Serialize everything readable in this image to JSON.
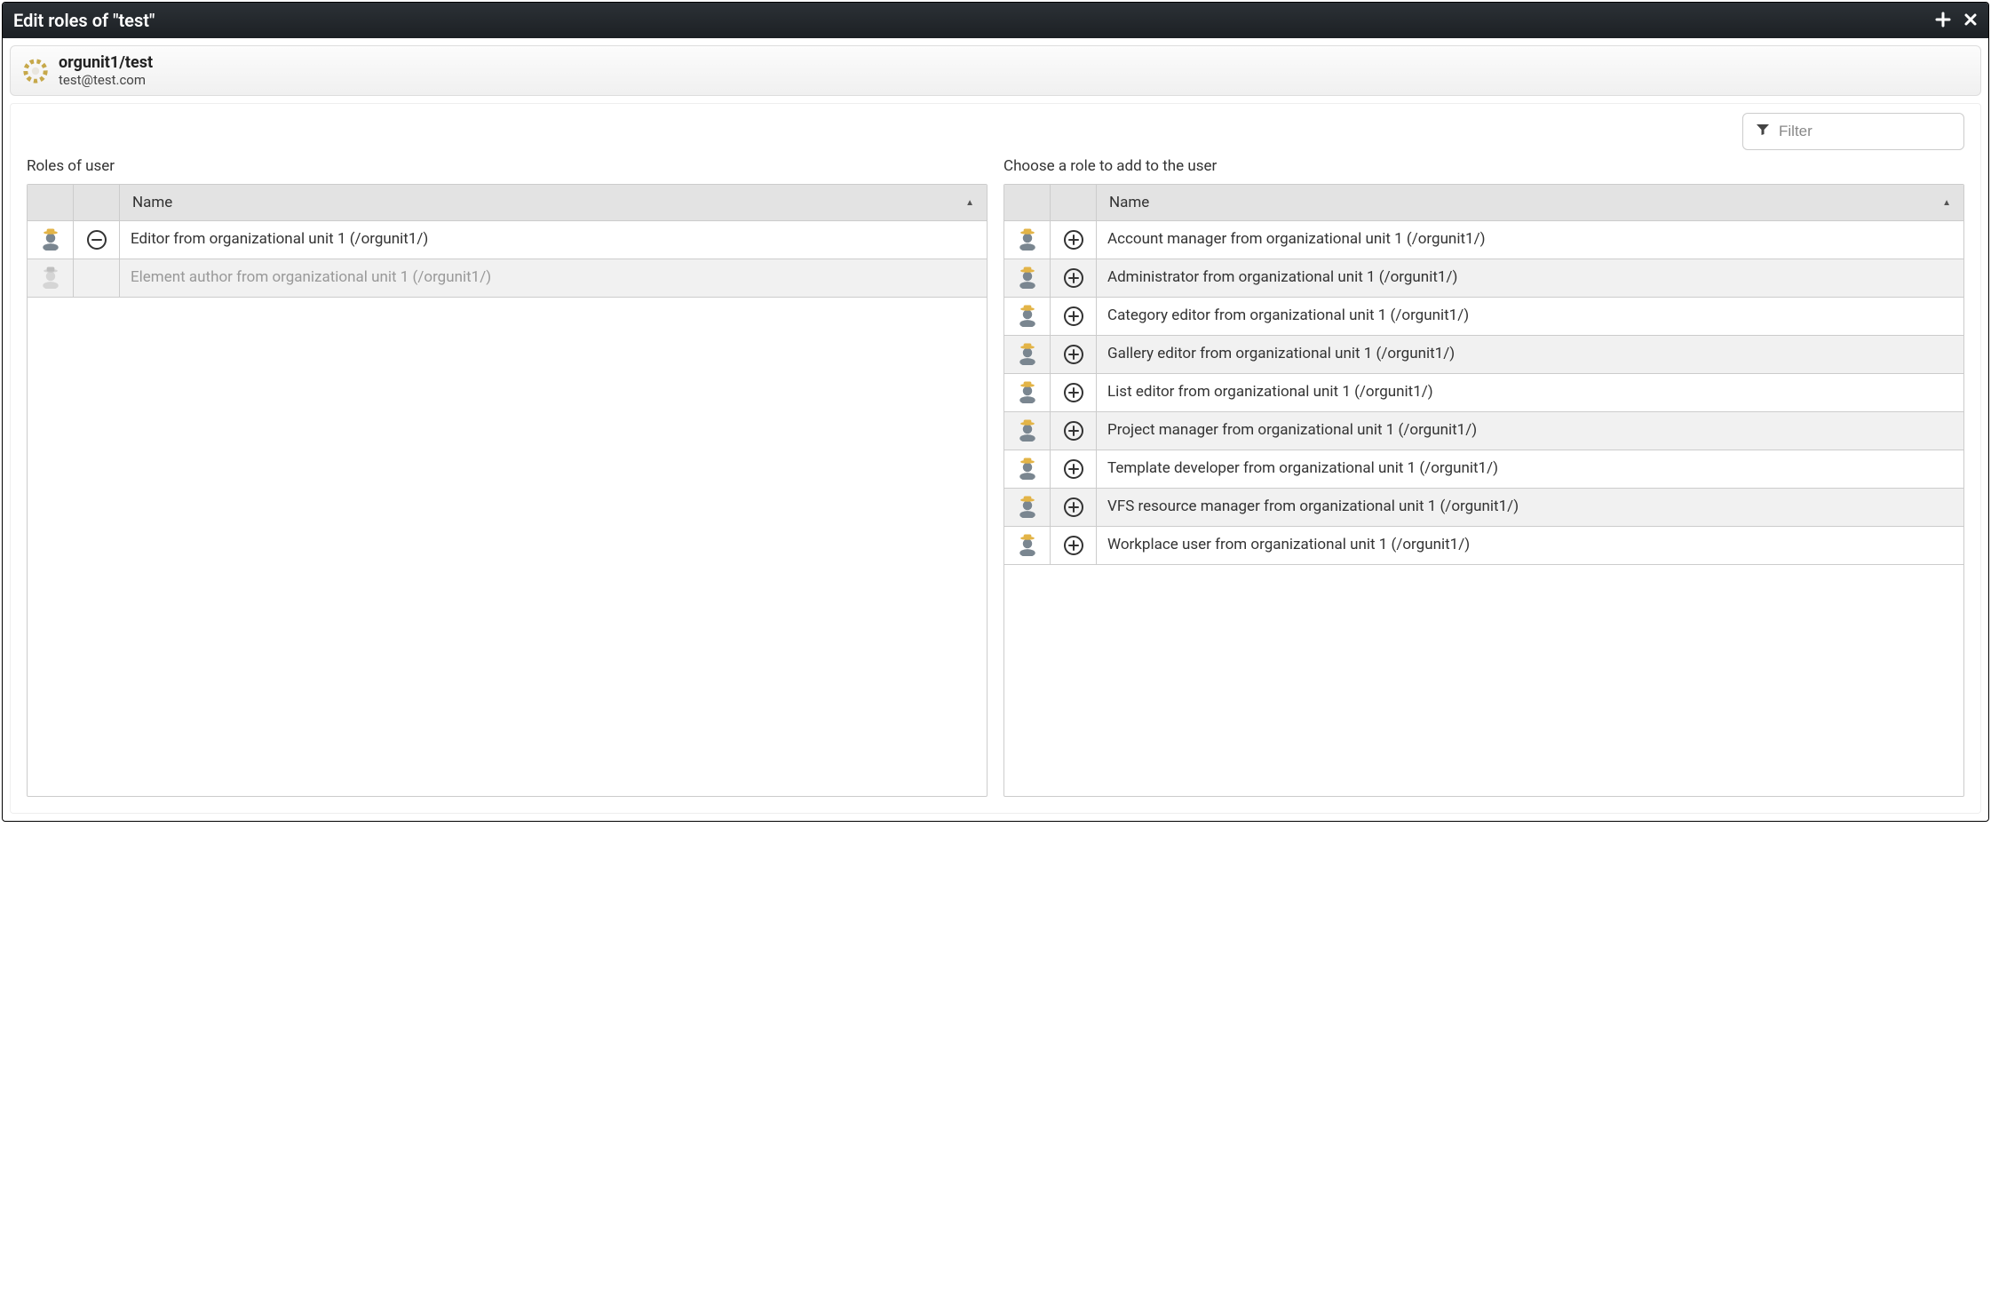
{
  "window": {
    "title": "Edit roles of \"test\""
  },
  "user": {
    "path": "orgunit1/test",
    "email": "test@test.com"
  },
  "filter": {
    "placeholder": "Filter"
  },
  "left": {
    "label": "Roles of user",
    "column_header": "Name",
    "rows": [
      {
        "name": "Editor from organizational unit 1 (/orgunit1/)",
        "action": "remove",
        "muted": false
      },
      {
        "name": "Element author from organizational unit 1 (/orgunit1/)",
        "action": "none",
        "muted": true
      }
    ]
  },
  "right": {
    "label": "Choose a role to add to the user",
    "column_header": "Name",
    "rows": [
      {
        "name": "Account manager from organizational unit 1 (/orgunit1/)",
        "action": "add"
      },
      {
        "name": "Administrator from organizational unit 1 (/orgunit1/)",
        "action": "add"
      },
      {
        "name": "Category editor from organizational unit 1 (/orgunit1/)",
        "action": "add"
      },
      {
        "name": "Gallery editor from organizational unit 1 (/orgunit1/)",
        "action": "add"
      },
      {
        "name": "List editor from organizational unit 1 (/orgunit1/)",
        "action": "add"
      },
      {
        "name": "Project manager from organizational unit 1 (/orgunit1/)",
        "action": "add"
      },
      {
        "name": "Template developer from organizational unit 1 (/orgunit1/)",
        "action": "add"
      },
      {
        "name": "VFS resource manager from organizational unit 1 (/orgunit1/)",
        "action": "add"
      },
      {
        "name": "Workplace user from organizational unit 1 (/orgunit1/)",
        "action": "add"
      }
    ]
  }
}
